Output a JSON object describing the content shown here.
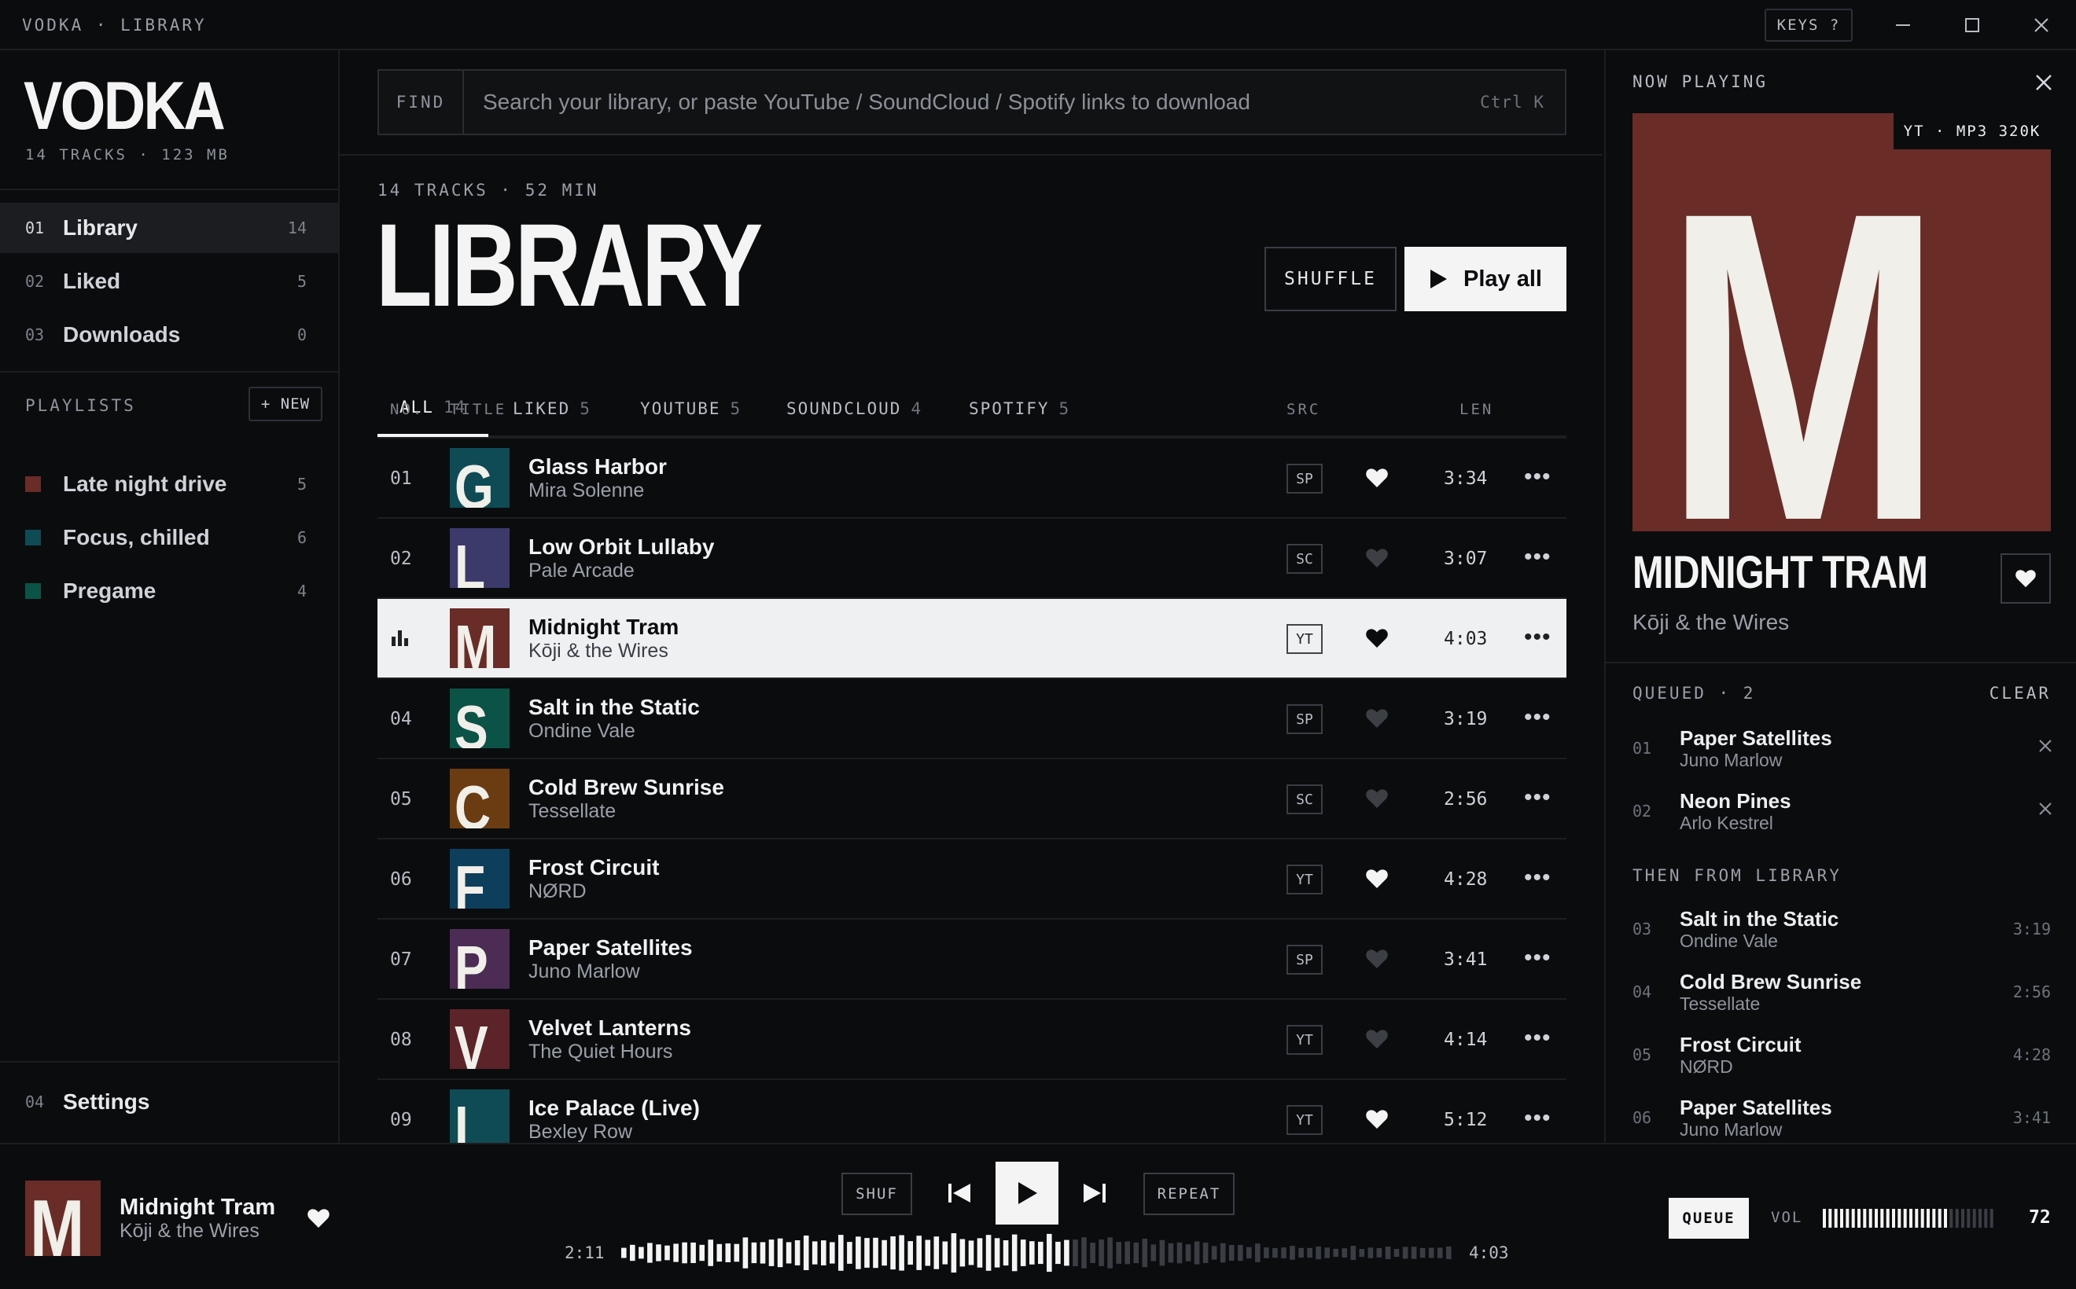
{
  "window": {
    "title": "VODKA · LIBRARY",
    "keys_label": "KEYS ?"
  },
  "sidebar": {
    "logo": "VODKA",
    "stats": "14 TRACKS · 123 MB",
    "nav": [
      {
        "num": "01",
        "label": "Library",
        "count": "14",
        "active": true
      },
      {
        "num": "02",
        "label": "Liked",
        "count": "5"
      },
      {
        "num": "03",
        "label": "Downloads",
        "count": "0"
      }
    ],
    "playlists_label": "PLAYLISTS",
    "new_label": "+ NEW",
    "playlists": [
      {
        "label": "Late night drive",
        "count": "5",
        "color": "#6a2c26"
      },
      {
        "label": "Focus, chilled",
        "count": "6",
        "color": "#0e4b55"
      },
      {
        "label": "Pregame",
        "count": "4",
        "color": "#0b5347"
      }
    ],
    "settings": {
      "num": "04",
      "label": "Settings"
    }
  },
  "search": {
    "label": "FIND",
    "placeholder": "Search your library, or paste YouTube / SoundCloud / Spotify links to download",
    "shortcut": "Ctrl K"
  },
  "library": {
    "meta": "14 TRACKS · 52 MIN",
    "title": "LIBRARY",
    "shuffle_label": "SHUFFLE",
    "play_all_label": "Play all",
    "tabs": [
      {
        "label": "ALL",
        "count": "14",
        "active": true
      },
      {
        "label": "LIKED",
        "count": "5"
      },
      {
        "label": "YOUTUBE",
        "count": "5"
      },
      {
        "label": "SOUNDCLOUD",
        "count": "4"
      },
      {
        "label": "SPOTIFY",
        "count": "5"
      }
    ],
    "columns": {
      "no": "NO.",
      "title": "TITLE",
      "src": "SRC",
      "len": "LEN"
    },
    "tracks": [
      {
        "no": "01",
        "title": "Glass Harbor",
        "artist": "Mira Solenne",
        "src": "SP",
        "liked": true,
        "len": "3:34",
        "letter": "G",
        "color": "#0e4b55"
      },
      {
        "no": "02",
        "title": "Low Orbit Lullaby",
        "artist": "Pale Arcade",
        "src": "SC",
        "liked": false,
        "len": "3:07",
        "letter": "L",
        "color": "#3b3a6b"
      },
      {
        "no": "03",
        "title": "Midnight Tram",
        "artist": "Kōji & the Wires",
        "src": "YT",
        "liked": true,
        "len": "4:03",
        "letter": "M",
        "color": "#6a2c26",
        "playing": true
      },
      {
        "no": "04",
        "title": "Salt in the Static",
        "artist": "Ondine Vale",
        "src": "SP",
        "liked": false,
        "len": "3:19",
        "letter": "S",
        "color": "#0b5347"
      },
      {
        "no": "05",
        "title": "Cold Brew Sunrise",
        "artist": "Tessellate",
        "src": "SC",
        "liked": false,
        "len": "2:56",
        "letter": "C",
        "color": "#6b3c12"
      },
      {
        "no": "06",
        "title": "Frost Circuit",
        "artist": "NØRD",
        "src": "YT",
        "liked": true,
        "len": "4:28",
        "letter": "F",
        "color": "#0d3f5c"
      },
      {
        "no": "07",
        "title": "Paper Satellites",
        "artist": "Juno Marlow",
        "src": "SP",
        "liked": false,
        "len": "3:41",
        "letter": "P",
        "color": "#4c2c55"
      },
      {
        "no": "08",
        "title": "Velvet Lanterns",
        "artist": "The Quiet Hours",
        "src": "YT",
        "liked": false,
        "len": "4:14",
        "letter": "V",
        "color": "#5c2428"
      },
      {
        "no": "09",
        "title": "Ice Palace (Live)",
        "artist": "Bexley Row",
        "src": "YT",
        "liked": true,
        "len": "5:12",
        "letter": "I",
        "color": "#0e4b55"
      }
    ]
  },
  "now_playing": {
    "label": "NOW PLAYING",
    "badge": "YT · MP3 320K",
    "art_letter": "M",
    "art_color": "#6a2c26",
    "title": "MIDNIGHT TRAM",
    "artist": "Kōji & the Wires",
    "queued_label": "QUEUED · 2",
    "clear_label": "CLEAR",
    "queued": [
      {
        "num": "01",
        "title": "Paper Satellites",
        "artist": "Juno Marlow"
      },
      {
        "num": "02",
        "title": "Neon Pines",
        "artist": "Arlo Kestrel"
      }
    ],
    "then_label": "THEN FROM LIBRARY",
    "then": [
      {
        "num": "03",
        "title": "Salt in the Static",
        "artist": "Ondine Vale",
        "len": "3:19"
      },
      {
        "num": "04",
        "title": "Cold Brew Sunrise",
        "artist": "Tessellate",
        "len": "2:56"
      },
      {
        "num": "05",
        "title": "Frost Circuit",
        "artist": "NØRD",
        "len": "4:28"
      },
      {
        "num": "06",
        "title": "Paper Satellites",
        "artist": "Juno Marlow",
        "len": "3:41"
      }
    ]
  },
  "player": {
    "title": "Midnight Tram",
    "artist": "Kōji & the Wires",
    "art_letter": "M",
    "shuf_label": "SHUF",
    "repeat_label": "REPEAT",
    "current": "2:11",
    "total": "4:03",
    "progress": 0.54,
    "queue_label": "QUEUE",
    "vol_label": "VOL",
    "volume": "72"
  }
}
